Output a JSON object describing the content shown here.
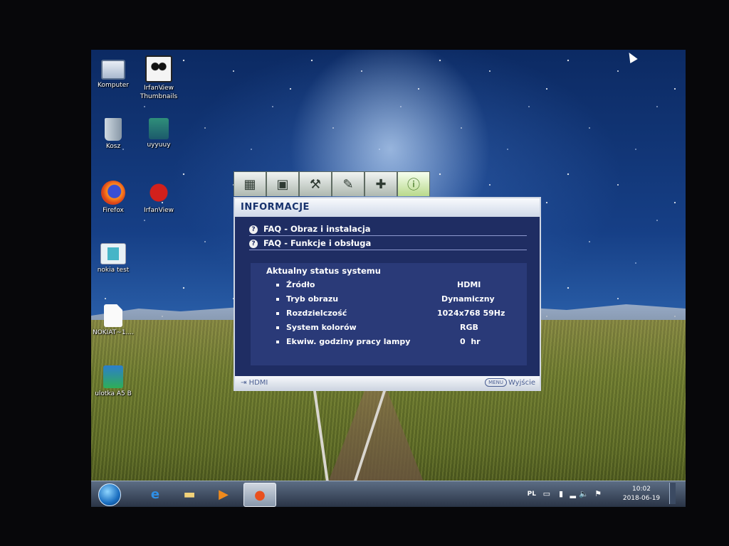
{
  "desktop": {
    "icons": [
      {
        "label": "Komputer",
        "icon": "computer-icon"
      },
      {
        "label": "IrfanView\nThumbnails",
        "icon": "irfanview-thumbnails-icon"
      },
      {
        "label": "Kosz",
        "icon": "recycle-bin-icon"
      },
      {
        "label": "uyyuuy",
        "icon": "winrar-archive-icon"
      },
      {
        "label": "Firefox",
        "icon": "firefox-icon"
      },
      {
        "label": "IrfanView",
        "icon": "irfanview-icon"
      },
      {
        "label": "nokia test",
        "icon": "image-file-icon"
      },
      {
        "label": "NOKIAT~1....",
        "icon": "blank-file-icon"
      },
      {
        "label": "ulotka A5 B",
        "icon": "document-file-icon"
      }
    ]
  },
  "osd": {
    "tabs": [
      "picture-tab-icon",
      "image-tab-icon",
      "setup-tab-icon",
      "settings-tab-icon",
      "advanced-tab-icon",
      "info-tab-icon"
    ],
    "title": "INFORMACJE",
    "faq": [
      "FAQ - Obraz i instalacja",
      "FAQ - Funkcje i obsługa"
    ],
    "status_title": "Aktualny status systemu",
    "status_rows": [
      {
        "label": "Źródło",
        "value": "HDMI"
      },
      {
        "label": "Tryb obrazu",
        "value": "Dynamiczny"
      },
      {
        "label": "Rozdzielczość",
        "value": "1024x768 59Hz"
      },
      {
        "label": "System kolorów",
        "value": "RGB"
      },
      {
        "label": "Ekwiw. godziny pracy lampy",
        "value": "0  hr"
      }
    ],
    "footer_source": "HDMI",
    "footer_menu_pill": "MENU",
    "footer_exit": "Wyjście"
  },
  "taskbar": {
    "pinned": [
      "internet-explorer-icon",
      "explorer-icon",
      "media-player-icon",
      "firefox-icon"
    ],
    "language": "PL",
    "time": "10:02",
    "date": "2018-06-19"
  },
  "colors": {
    "osd_bg": "#1f2d63",
    "osd_panel": "#2a3a78",
    "osd_header_text": "#17326d",
    "active_tab": "#b9d98b"
  }
}
